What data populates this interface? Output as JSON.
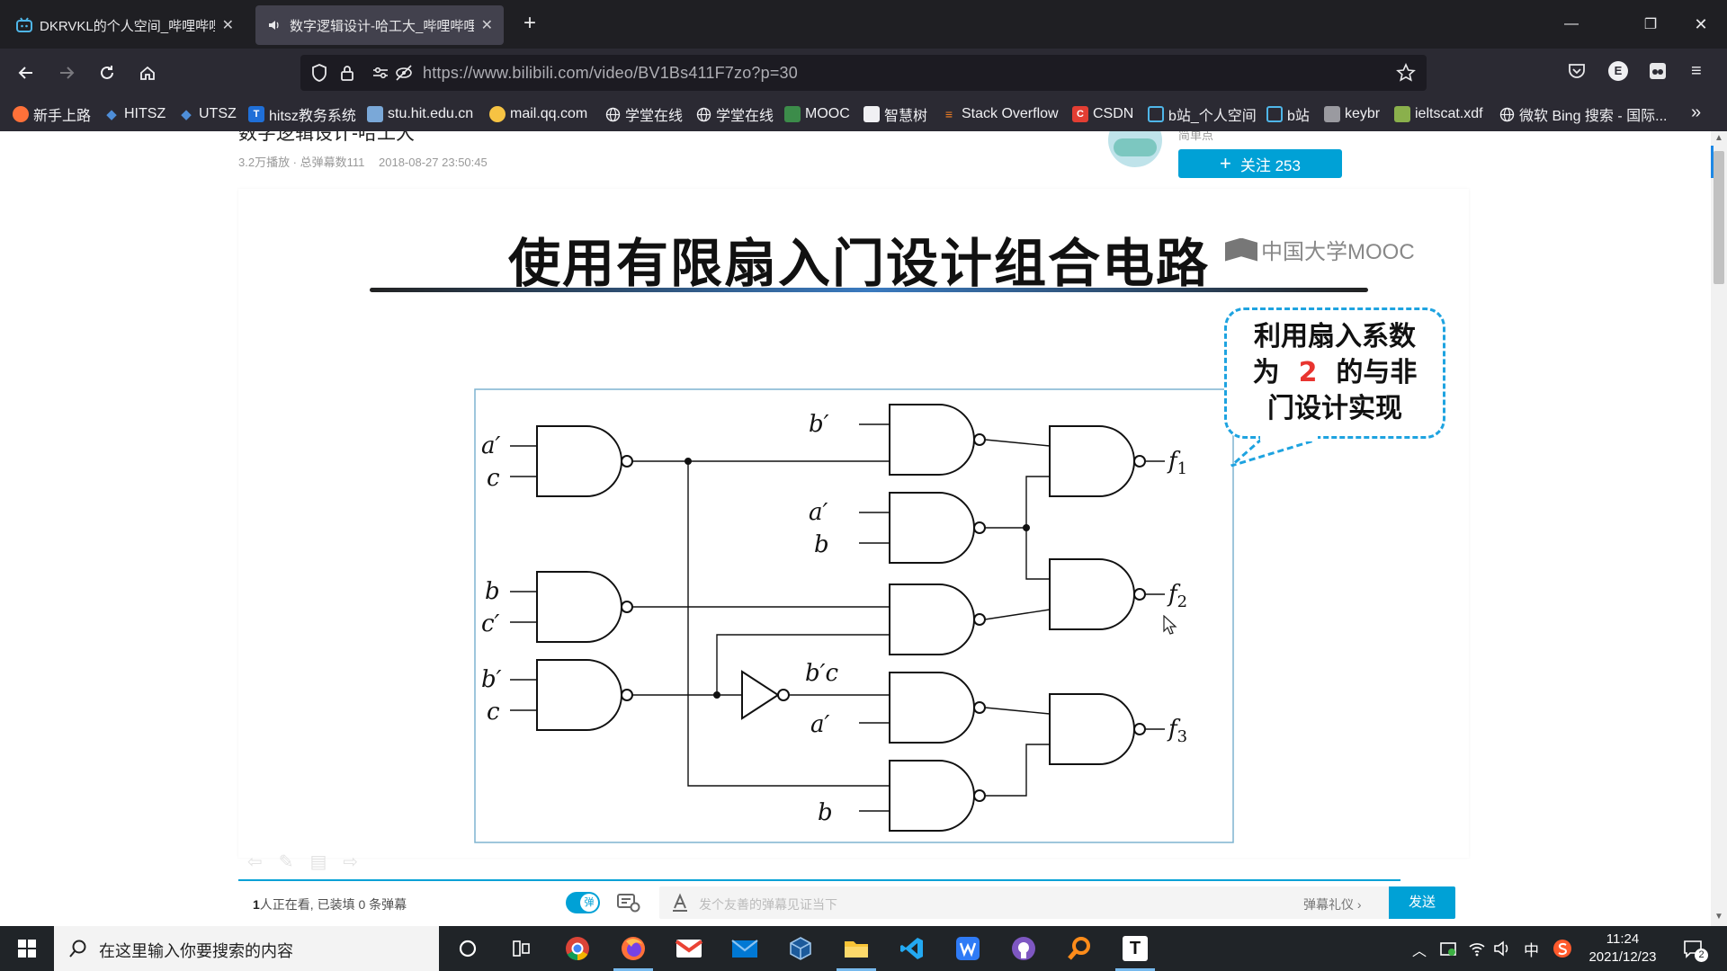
{
  "browser": {
    "tabs": [
      {
        "title": "DKRVKL的个人空间_哔哩哔哩_",
        "icon": "bilibili-icon"
      },
      {
        "title": "数字逻辑设计-哈工大_哔哩哔哩",
        "icon": "speaker-icon"
      }
    ],
    "url": "https://www.bilibili.com/video/BV1Bs411F7zo?p=30",
    "bookmarks": [
      "新手上路",
      "HITSZ",
      "UTSZ",
      "hitsz教务系统",
      "stu.hit.edu.cn",
      "mail.qq.com",
      "学堂在线",
      "学堂在线",
      "MOOC",
      "智慧树",
      "Stack Overflow",
      "CSDN",
      "b站_个人空间",
      "b站",
      "keybr",
      "ieltscat.xdf",
      "微软 Bing 搜索 - 国际..."
    ],
    "profile_initial": "E"
  },
  "video": {
    "title": "数字逻辑设计-哈工大",
    "views": "3.2万播放 · 总弹幕数111",
    "date": "2018-08-27 23:50:45",
    "uploader_sign": "简单点",
    "follow_label": "关注 253"
  },
  "slide": {
    "title": "使用有限扇入门设计组合电路",
    "mooc_logo": "中国大学MOOC",
    "callout_line1": "利用扇入系数",
    "callout_pre": "为",
    "callout_num": "2",
    "callout_post": "的与非",
    "callout_line3": "门设计实现",
    "inputs": [
      "a′",
      "c",
      "b",
      "c′",
      "b′",
      "c",
      "b′",
      "a′",
      "b",
      "b′c",
      "a′",
      "b"
    ],
    "outputs": [
      "f",
      "1",
      "f",
      "2",
      "f",
      "3"
    ]
  },
  "danmaku": {
    "status_count": "1",
    "status_text": "人正在看, 已装填 0 条弹幕",
    "toggle_label": "弹",
    "placeholder": "发个友善的弹幕见证当下",
    "etiquette": "弹幕礼仪 ›",
    "send": "发送"
  },
  "taskbar": {
    "search_placeholder": "在这里输入你要搜索的内容",
    "time": "11:24",
    "date": "2021/12/23",
    "ime": "中",
    "notif_count": "2"
  },
  "colors": {
    "bilibili_blue": "#00a1d6",
    "tab_bg": "#1f1f23",
    "nav_bg": "#2b2a33",
    "callout_red": "#e8342f"
  }
}
